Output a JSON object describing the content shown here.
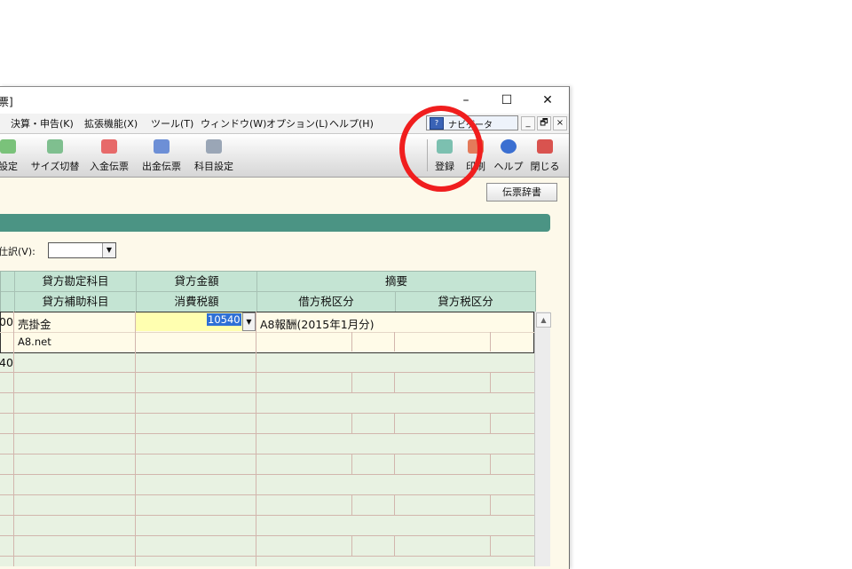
{
  "window": {
    "title_fragment": "票]",
    "controls": {
      "minimize": "–",
      "maximize": "☐",
      "close": "✕"
    }
  },
  "menu": {
    "items": [
      "決算・申告(K)",
      "拡張機能(X)",
      "ツール(T)",
      "ウィンドウ(W)",
      "オプション(L)",
      "ヘルプ(H)"
    ],
    "navigator_label": "ナビゲータ",
    "mdi_controls": [
      "_",
      "🗗",
      "×"
    ]
  },
  "toolbar": {
    "left_tools": [
      "設定",
      "サイズ切替",
      "入金伝票",
      "出金伝票",
      "科目設定"
    ],
    "right_tools": [
      "登録",
      "印刷",
      "ヘルプ",
      "閉じる"
    ],
    "dict_button": "伝票辞書"
  },
  "form": {
    "shiwake_label": "仕訳(V):",
    "combo_value": ""
  },
  "grid": {
    "headers_top": [
      "貸方勘定科目",
      "貸方金額",
      "摘要"
    ],
    "headers_bottom": [
      "貸方補助科目",
      "消費税額",
      "借方税区分",
      "貸方税区分"
    ],
    "rows": [
      {
        "left_fragment": "00",
        "account": "売掛金",
        "amount": "10540",
        "memo": "A8報酬(2015年1月分)",
        "sub_account": "A8.net"
      },
      {
        "left_fragment": "40"
      }
    ]
  },
  "annotation": {
    "color": "#f01e1e",
    "target": "登録"
  }
}
